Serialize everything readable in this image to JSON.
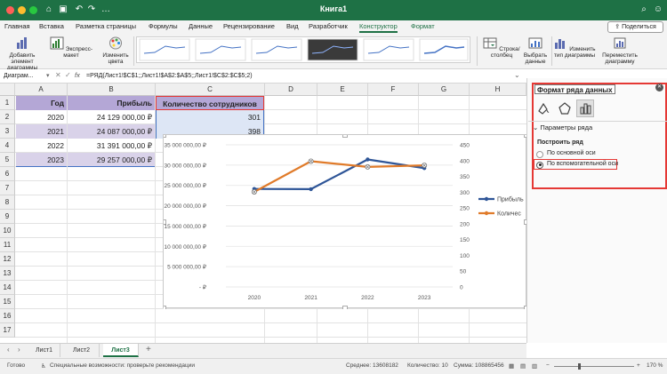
{
  "window": {
    "title": "Книга1"
  },
  "tabs": [
    {
      "label": "Главная",
      "active": false
    },
    {
      "label": "Вставка",
      "active": false
    },
    {
      "label": "Разметка страницы",
      "active": false
    },
    {
      "label": "Формулы",
      "active": false
    },
    {
      "label": "Данные",
      "active": false
    },
    {
      "label": "Рецензирование",
      "active": false
    },
    {
      "label": "Вид",
      "active": false
    },
    {
      "label": "Разработчик",
      "active": false
    },
    {
      "label": "Конструктор",
      "active": true
    },
    {
      "label": "Формат",
      "active": false
    }
  ],
  "share_label": "Поделиться",
  "ribbon": {
    "add_element": "Добавить элемент диаграммы",
    "quick_layout": "Экспресс-макет",
    "change_colors": "Изменить цвета",
    "switch_rowcol": "Строка/столбец",
    "select_data": "Выбрать данные",
    "change_type": "Изменить тип диаграммы",
    "move_chart": "Переместить диаграмму"
  },
  "formula_bar": {
    "name_box": "Диаграм...",
    "fx": "fx",
    "formula": "=РЯД(Лист1!$C$1;;Лист1!$A$2:$A$5;;Лист1!$C$2:$C$5;2)"
  },
  "columns": [
    "A",
    "B",
    "C",
    "D",
    "E",
    "F",
    "G",
    "H"
  ],
  "rows": [
    "1",
    "2",
    "3",
    "4",
    "5",
    "6",
    "7",
    "8",
    "9",
    "10",
    "11",
    "12",
    "13",
    "14",
    "15",
    "16",
    "17"
  ],
  "table": {
    "headers": [
      "Год",
      "Прибыль",
      "Количество сотрудников"
    ],
    "rows": [
      [
        "2020",
        "24 129 000,00 ₽",
        "301"
      ],
      [
        "2021",
        "24 087 000,00 ₽",
        "398"
      ],
      [
        "2022",
        "31 391 000,00 ₽",
        ""
      ],
      [
        "2023",
        "29 257 000,00 ₽",
        ""
      ]
    ]
  },
  "chart_data": {
    "type": "line",
    "categories": [
      "2020",
      "2021",
      "2022",
      "2023"
    ],
    "series": [
      {
        "name": "Прибыль",
        "axis": "primary",
        "color": "#2e5597",
        "values": [
          24129000,
          24087000,
          31391000,
          29257000
        ]
      },
      {
        "name": "Количество сотрудников",
        "axis": "secondary",
        "color": "#e07b2a",
        "values": [
          301,
          398,
          380,
          385
        ]
      }
    ],
    "primary_ticks": [
      "35 000 000,00 ₽",
      "30 000 000,00 ₽",
      "25 000 000,00 ₽",
      "20 000 000,00 ₽",
      "15 000 000,00 ₽",
      "10 000 000,00 ₽",
      "5 000 000,00 ₽",
      "- ₽"
    ],
    "secondary_ticks": [
      "450",
      "400",
      "350",
      "300",
      "250",
      "200",
      "150",
      "100",
      "50",
      "0"
    ],
    "primary_ylim": [
      0,
      35000000
    ],
    "secondary_ylim": [
      0,
      450
    ],
    "legend_labels": [
      "Прибыль",
      "Количес"
    ],
    "legend_position": "right",
    "grid": true
  },
  "panel": {
    "title": "Формат ряда данных",
    "section": "Параметры ряда",
    "build_on": "Построить ряд",
    "primary_axis": "По основной оси",
    "secondary_axis": "По вспомогательной оси",
    "selected_axis": "secondary"
  },
  "sheet_tabs": [
    {
      "label": "Лист1",
      "active": false
    },
    {
      "label": "Лист2",
      "active": false
    },
    {
      "label": "Лист3",
      "active": true
    }
  ],
  "status": {
    "ready": "Готово",
    "accessibility": "Специальные возможности: проверьте рекомендации",
    "average": "Среднее: 13608182",
    "count": "Количество: 10",
    "sum": "Сумма: 108865456",
    "zoom": "170 %"
  },
  "colors": {
    "titlebar": "#1e7145",
    "table_header": "#b4a7d6",
    "row_band": "#d9d2e9",
    "highlight": "#e53935"
  }
}
